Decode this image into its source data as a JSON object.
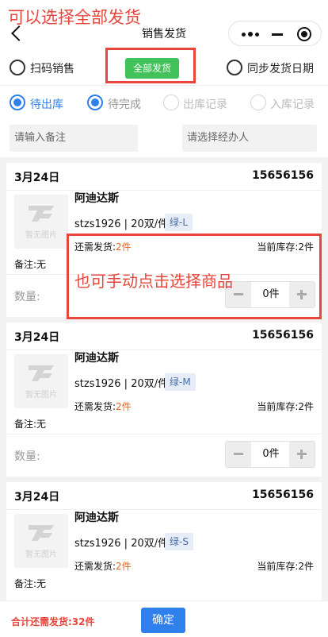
{
  "header": {
    "title": "销售发货",
    "back_icon": "chevron-left-icon",
    "capsule": [
      "more-icon",
      "minimize-icon",
      "close-circle-icon"
    ]
  },
  "annotations": {
    "top": "可以选择全部发货",
    "middle": "也可手动点击选择商品",
    "color": "#e8453c"
  },
  "options": {
    "scan_sale": "扫码销售",
    "ship_all": "全部发货",
    "sync_date": "同步发货日期"
  },
  "status_tabs": [
    {
      "label": "待出库",
      "active": true
    },
    {
      "label": "待完成",
      "active": true
    },
    {
      "label": "出库记录",
      "active": false
    },
    {
      "label": "入库记录",
      "active": false
    }
  ],
  "filters": {
    "remark_placeholder": "请输入备注",
    "handler_placeholder": "请选择经办人"
  },
  "orders": [
    {
      "date": "3月24日",
      "code": "15656156",
      "product": "阿迪达斯",
      "spec": "stzs1926 | 20双/件",
      "color": "绿-L",
      "need_label": "还需发货:",
      "need_value": "2件",
      "stock_label": "当前库存:",
      "stock_value": "2件",
      "remark": "备注:无",
      "qty_label": "数量:",
      "qty_value": "0件",
      "thumb_text": "暂无图片"
    },
    {
      "date": "3月24日",
      "code": "15656156",
      "product": "阿迪达斯",
      "spec": "stzs1926 | 20双/件",
      "color": "绿-M",
      "need_label": "还需发货:",
      "need_value": "2件",
      "stock_label": "当前库存:",
      "stock_value": "2件",
      "remark": "备注:无",
      "qty_label": "数量:",
      "qty_value": "0件",
      "thumb_text": "暂无图片"
    },
    {
      "date": "3月24日",
      "code": "15656156",
      "product": "阿迪达斯",
      "spec": "stzs1926 | 20双/件",
      "color": "绿-S",
      "need_label": "还需发货:",
      "need_value": "2件",
      "stock_label": "当前库存:",
      "stock_value": "2件",
      "remark": "备注:无",
      "thumb_text": "暂无图片"
    }
  ],
  "footer": {
    "total": "合计还需发货:32件",
    "confirm": "确定"
  },
  "colors": {
    "primary": "#2f80ed",
    "ship_all_green": "#41c35a",
    "need_orange": "#e8641e"
  }
}
